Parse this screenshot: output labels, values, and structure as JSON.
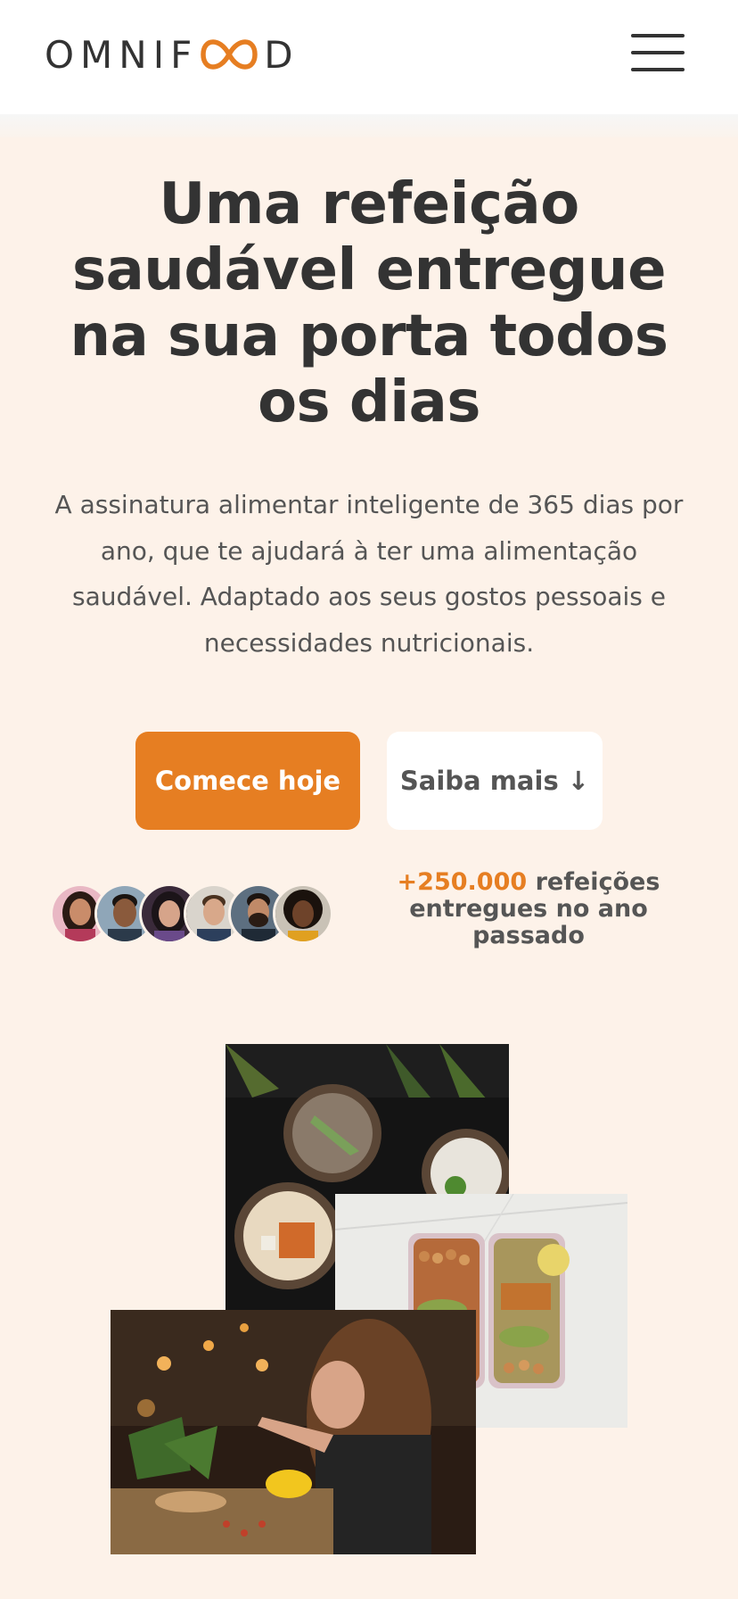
{
  "header": {
    "logo_text": "OMNIFOOD",
    "logo_before": "OMNIF",
    "logo_after": "D",
    "menu_icon": "hamburger-menu-icon"
  },
  "hero": {
    "title": "Uma refeição saudável entregue na sua porta todos os dias",
    "description": "A assinatura alimentar inteligente de 365 dias por ano, que te ajudará à ter uma alimentação saudável. Adaptado aos seus gostos pessoais e necessidades nutricionais.",
    "cta_primary": "Comece hoje",
    "cta_secondary": "Saiba mais ↓"
  },
  "delivered": {
    "highlight": "+250.000",
    "text": "refeições entregues no ano passado"
  },
  "colors": {
    "accent": "#e67e22",
    "background": "#fdf2e9",
    "text_dark": "#333333",
    "text_medium": "#555555"
  }
}
